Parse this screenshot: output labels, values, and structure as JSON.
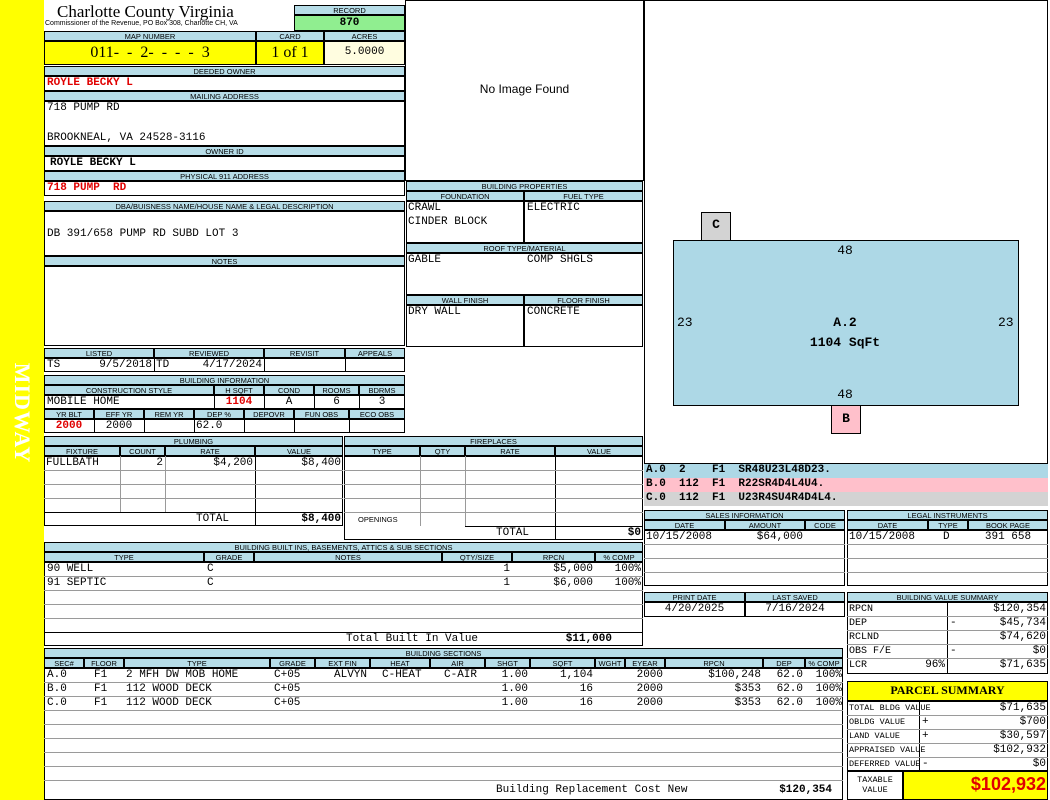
{
  "sidebar": {
    "label": "MIDWAY",
    "color": "#ffff00"
  },
  "county": {
    "title": "Charlotte County Virginia",
    "subtitle": "Commissioner of the Revenue, PO Box 308, Charlotte CH, VA"
  },
  "record": {
    "label": "RECORD",
    "value": "870"
  },
  "map": {
    "label": "MAP NUMBER",
    "value": "011-  -  2-  -  -  -  3"
  },
  "card": {
    "label": "CARD",
    "value": "1 of 1"
  },
  "acres": {
    "label": "ACRES",
    "value": "5.0000"
  },
  "deeded_owner": {
    "label": "DEEDED OWNER",
    "value": "ROYLE BECKY L"
  },
  "mailing": {
    "label": "MAILING ADDRESS",
    "line1": "718 PUMP RD",
    "line2": "BROOKNEAL, VA 24528-3116"
  },
  "owner_id": {
    "label": "OWNER ID",
    "value": "ROYLE BECKY L"
  },
  "physical": {
    "label": "PHYSICAL 911 ADDRESS",
    "value": "718 PUMP  RD"
  },
  "dba": {
    "label": "DBA/BUISNESS NAME/HOUSE NAME & LEGAL DESCRIPTION",
    "value": "DB 391/658 PUMP RD SUBD LOT 3"
  },
  "notes": {
    "label": "NOTES"
  },
  "image": {
    "text": "No Image Found"
  },
  "listing": {
    "listed_label": "LISTED",
    "reviewed_label": "REVIEWED",
    "revisit_label": "REVISIT",
    "appeals_label": "APPEALS",
    "listed_by": "TS",
    "listed_date": "9/5/2018",
    "reviewed_by": "TD",
    "reviewed_date": "4/17/2024"
  },
  "building_info": {
    "label": "BUILDING INFORMATION",
    "h_style": "CONSTRUCTION STYLE",
    "h_sqft": "H SQFT",
    "h_cond": "COND",
    "h_rooms": "ROOMS",
    "h_bdrms": "BDRMS",
    "style": "MOBILE HOME",
    "sqft": "1104",
    "cond": "A",
    "rooms": "6",
    "bdrms": "3",
    "h_yrblt": "YR BLT",
    "h_effyr": "EFF YR",
    "h_remyr": "REM YR",
    "h_dep": "DEP %",
    "h_depovr": "DEPOVR",
    "h_funobs": "FUN OBS",
    "h_ecoobs": "ECO OBS",
    "yrblt": "2000",
    "effyr": "2000",
    "dep": "62.0"
  },
  "building_props": {
    "label": "BUILDING PROPERTIES",
    "foundation_label": "FOUNDATION",
    "fuel_label": "FUEL TYPE",
    "foundation1": "CRAWL",
    "foundation2": "CINDER BLOCK",
    "fuel": "ELECTRIC",
    "roof_label": "ROOF TYPE/MATERIAL",
    "roof_type": "GABLE",
    "roof_mat": "COMP SHGLS",
    "wall_label": "WALL FINISH",
    "floor_label": "FLOOR FINISH",
    "wall": "DRY WALL",
    "floor": "CONCRETE"
  },
  "plumbing": {
    "label": "PLUMBING",
    "h_fixture": "FIXTURE",
    "h_count": "COUNT",
    "h_rate": "RATE",
    "h_value": "VALUE",
    "rows": [
      {
        "fixture": "FULLBATH",
        "count": "2",
        "rate": "$4,200",
        "value": "$8,400"
      }
    ],
    "total_label": "TOTAL",
    "total": "$8,400"
  },
  "fireplaces": {
    "label": "FIREPLACES",
    "h_type": "TYPE",
    "h_qty": "QTY",
    "h_rate": "RATE",
    "h_value": "VALUE",
    "openings_label": "OPENINGS",
    "total_label": "TOTAL",
    "total": "$0"
  },
  "sketch": {
    "c_label": "C",
    "b_label": "B",
    "top": "48",
    "bottom": "48",
    "left": "23",
    "right": "23",
    "area_name": "A.2",
    "area_sqft": "1104 SqFt",
    "main_color": "#add8e6",
    "b_color": "#ffc0cb",
    "c_color": "#d3d3d3"
  },
  "sketch_rows": [
    {
      "text": "A.0  2    F1  SR48U23L48D23.",
      "color": "#add8e6"
    },
    {
      "text": "B.0  112  F1  R22SR4D4L4U4.",
      "color": "#ffc0cb"
    },
    {
      "text": "C.0  112  F1  U23R4SU4R4D4L4.",
      "color": "#d3d3d3"
    }
  ],
  "sales": {
    "label": "SALES INFORMATION",
    "h_date": "DATE",
    "h_amount": "AMOUNT",
    "h_code": "CODE",
    "date": "10/15/2008",
    "amount": "$64,000"
  },
  "legal": {
    "label": "LEGAL INSTRUMENTS",
    "h_date": "DATE",
    "h_type": "TYPE",
    "h_book": "BOOK PAGE",
    "date": "10/15/2008",
    "type": "D",
    "book": "391 658"
  },
  "print": {
    "print_label": "PRINT DATE",
    "saved_label": "LAST SAVED",
    "print_date": "4/20/2025",
    "saved_date": "7/16/2024"
  },
  "built_ins": {
    "label": "BUILDING BUILT INS, BASEMENTS, ATTICS & SUB SECTIONS",
    "h_type": "TYPE",
    "h_grade": "GRADE",
    "h_notes": "NOTES",
    "h_qty": "QTY/SIZE",
    "h_rpcn": "RPCN",
    "h_comp": "% COMP",
    "rows": [
      {
        "type": "90 WELL",
        "grade": "C",
        "qty": "1",
        "rpcn": "$5,000",
        "comp": "100%"
      },
      {
        "type": "91 SEPTIC",
        "grade": "C",
        "qty": "1",
        "rpcn": "$6,000",
        "comp": "100%"
      }
    ],
    "total_label": "Total Built In Value",
    "total": "$11,000"
  },
  "value_summary": {
    "label": "BUILDING VALUE SUMMARY",
    "rpcn_label": "RPCN",
    "rpcn": "$120,354",
    "dep_label": "DEP",
    "dep_sign": "-",
    "dep": "$45,734",
    "rclnd_label": "RCLND",
    "rclnd": "$74,620",
    "obs_label": "OBS F/E",
    "obs_sign": "-",
    "obs": "$0",
    "lcr_label": "LCR",
    "lcr_pct": "96%",
    "lcr": "$71,635"
  },
  "sections": {
    "label": "BUILDING SECTIONS",
    "h_sec": "SEC#",
    "h_floor": "FLOOR",
    "h_type": "TYPE",
    "h_grade": "GRADE",
    "h_extfin": "EXT FIN",
    "h_heat": "HEAT",
    "h_air": "AIR",
    "h_shgt": "SHGT",
    "h_sqft": "SQFT",
    "h_wght": "WGHT",
    "h_eyear": "EYEAR",
    "h_rpcn": "RPCN",
    "h_dep": "DEP",
    "h_comp": "% COMP",
    "rows": [
      {
        "sec": "A.0",
        "floor": "F1",
        "type": "2 MFH DW MOB HOME",
        "grade": "C+05",
        "extfin": "ALVYN",
        "heat": "C-HEAT",
        "air": "C-AIR",
        "shgt": "1.00",
        "sqft": "1,104",
        "eyear": "2000",
        "rpcn": "$100,248",
        "dep": "62.0",
        "comp": "100%"
      },
      {
        "sec": "B.0",
        "floor": "F1",
        "type": "112 WOOD DECK",
        "grade": "C+05",
        "extfin": "",
        "heat": "",
        "air": "",
        "shgt": "1.00",
        "sqft": "16",
        "eyear": "2000",
        "rpcn": "$353",
        "dep": "62.0",
        "comp": "100%"
      },
      {
        "sec": "C.0",
        "floor": "F1",
        "type": "112 WOOD DECK",
        "grade": "C+05",
        "extfin": "",
        "heat": "",
        "air": "",
        "shgt": "1.00",
        "sqft": "16",
        "eyear": "2000",
        "rpcn": "$353",
        "dep": "62.0",
        "comp": "100%"
      }
    ],
    "total_label": "Building Replacement Cost New",
    "total": "$120,354"
  },
  "parcel": {
    "label": "PARCEL SUMMARY",
    "bldg_label": "TOTAL BLDG VALUE",
    "bldg": "$71,635",
    "obldg_label": "OBLDG VALUE",
    "obldg_sign": "+",
    "obldg": "$700",
    "land_label": "LAND VALUE",
    "land_sign": "+",
    "land": "$30,597",
    "appraised_label": "APPRAISED VALUE",
    "appraised": "$102,932",
    "deferred_label": "DEFERRED VALUE",
    "deferred_sign": "-",
    "deferred": "$0",
    "taxable_label1": "TAXABLE",
    "taxable_label2": "VALUE",
    "taxable": "$102,932"
  }
}
